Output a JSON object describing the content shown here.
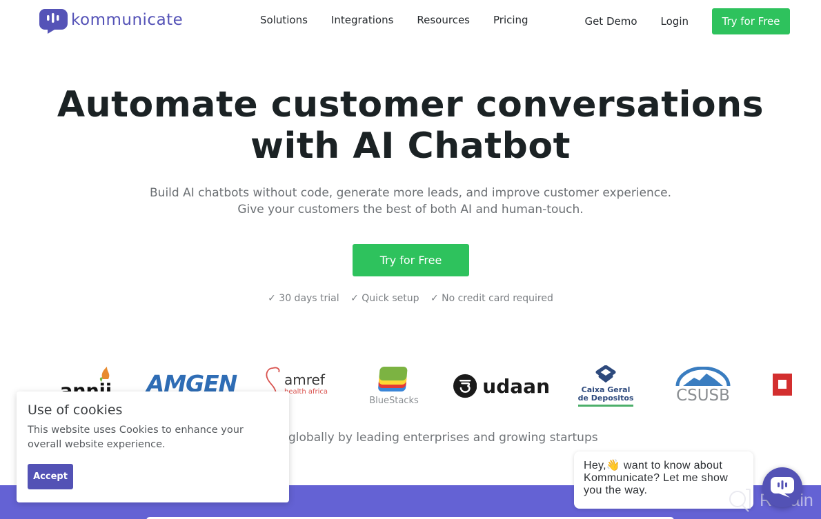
{
  "brand": {
    "name": "kommunicate",
    "primary": "#5553b7",
    "green": "#2ec25d",
    "band": "#6462d4"
  },
  "nav": {
    "items": [
      {
        "label": "Solutions"
      },
      {
        "label": "Integrations"
      },
      {
        "label": "Resources"
      },
      {
        "label": "Pricing"
      }
    ],
    "get_demo": "Get Demo",
    "login": "Login",
    "try_free": "Try for Free"
  },
  "hero": {
    "title_line1": "Automate customer conversations",
    "title_line2": "with AI Chatbot",
    "subtitle": "Build AI chatbots without code, generate more leads, and improve customer experience. Give your customers the best of both AI and human-touch.",
    "cta": "Try for Free",
    "perks": [
      "✓ 30 days trial",
      "✓ Quick setup",
      "✓ No credit card required"
    ]
  },
  "customers": {
    "logos": [
      {
        "name": "annii",
        "text": "annii"
      },
      {
        "name": "amgen",
        "text": "AMGEN"
      },
      {
        "name": "amref",
        "text": "amref",
        "subtext": "health africa"
      },
      {
        "name": "bluestacks",
        "text": "BlueStacks"
      },
      {
        "name": "udaan",
        "text": "udaan"
      },
      {
        "name": "caixa",
        "text": "Caixa Geral",
        "subtext": "de Depositos"
      },
      {
        "name": "csusb",
        "text": "CSUSB"
      }
    ],
    "trusted_text": "globally by leading enterprises and growing startups"
  },
  "cookie": {
    "title": "Use of cookies",
    "body": "This website uses Cookies to enhance your overall website experience.",
    "accept": "Accept"
  },
  "chat": {
    "message": "Hey,👋 want to know about Kommunicate? Let me show you the way."
  },
  "watermark": {
    "text": "Revain"
  }
}
